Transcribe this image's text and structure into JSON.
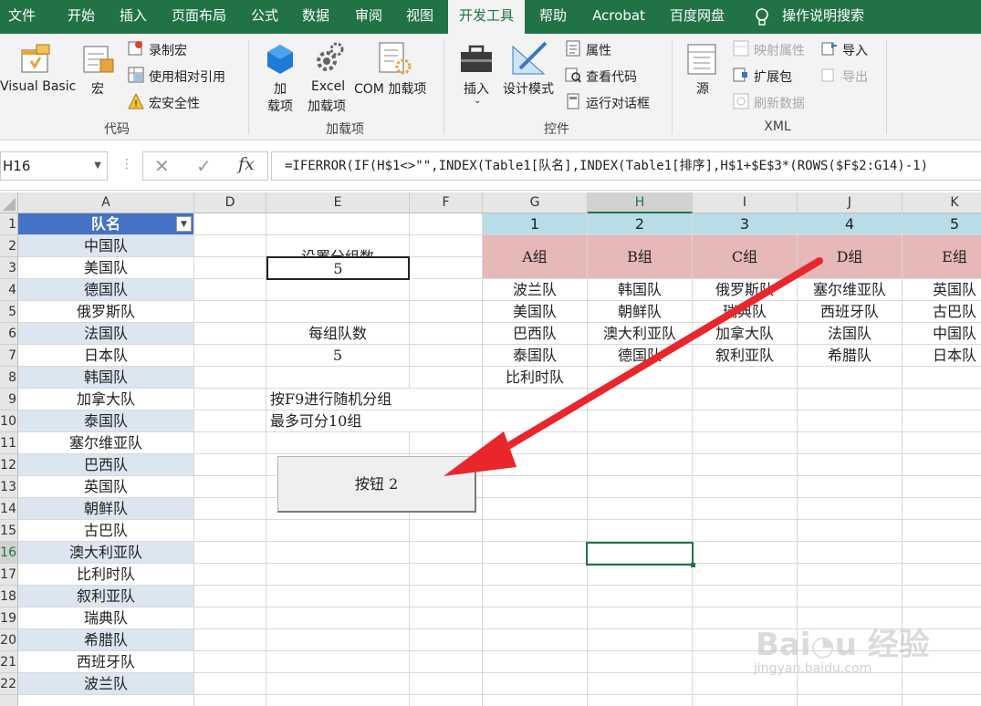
{
  "tabs": [
    "文件",
    "开始",
    "插入",
    "页面布局",
    "公式",
    "数据",
    "审阅",
    "视图",
    "开发工具",
    "帮助",
    "Acrobat",
    "百度网盘",
    "操作说明搜索"
  ],
  "active_tab": "开发工具",
  "ribbon": {
    "code": {
      "label": "代码",
      "visual_basic": "Visual Basic",
      "macro": "宏",
      "record_macro": "录制宏",
      "relative_ref": "使用相对引用",
      "macro_security": "宏安全性"
    },
    "addins": {
      "label": "加载项",
      "addin_l1": "加",
      "addin_l2": "载项",
      "excel_l1": "Excel",
      "excel_l2": "加载项",
      "com": "COM 加载项"
    },
    "controls": {
      "label": "控件",
      "insert": "插入",
      "design_mode": "设计模式",
      "properties": "属性",
      "view_code": "查看代码",
      "run_dialog": "运行对话框"
    },
    "xml": {
      "label": "XML",
      "source": "源",
      "map_props": "映射属性",
      "expansion": "扩展包",
      "refresh": "刷新数据",
      "import": "导入",
      "export": "导出"
    }
  },
  "formula_bar": {
    "name_box": "H16",
    "formula": "=IFERROR(IF(H$1<>\"\",INDEX(Table1[队名],INDEX(Table1[排序],H$1+$E$3*(ROWS($F$2:G14)-1)"
  },
  "columns": [
    "A",
    "D",
    "E",
    "F",
    "G",
    "H",
    "I",
    "J",
    "K"
  ],
  "rows": [
    "1",
    "2",
    "3",
    "4",
    "5",
    "6",
    "7",
    "8",
    "9",
    "10",
    "11",
    "12",
    "13",
    "14",
    "15",
    "16",
    "17",
    "18",
    "19",
    "20",
    "21",
    "22"
  ],
  "table": {
    "header": "队名",
    "teams": [
      "中国队",
      "美国队",
      "德国队",
      "俄罗斯队",
      "法国队",
      "日本队",
      "韩国队",
      "加拿大队",
      "泰国队",
      "塞尔维亚队",
      "巴西队",
      "英国队",
      "朝鲜队",
      "古巴队",
      "澳大利亚队",
      "比利时队",
      "叙利亚队",
      "瑞典队",
      "希腊队",
      "西班牙队",
      "波兰队"
    ]
  },
  "settings": {
    "group_count_label": "设置分组数",
    "group_count": "5",
    "per_group_label": "每组队数",
    "per_group": "5",
    "hint1": "按F9进行随机分组",
    "hint2": "最多可分10组",
    "button": "按钮 2"
  },
  "groups": {
    "numbers": [
      "1",
      "2",
      "3",
      "4",
      "5"
    ],
    "names": [
      "A组",
      "B组",
      "C组",
      "D组",
      "E组"
    ],
    "members": [
      [
        "波兰队",
        "美国队",
        "巴西队",
        "泰国队",
        "比利时队"
      ],
      [
        "韩国队",
        "朝鲜队",
        "澳大利亚队",
        "德国队"
      ],
      [
        "俄罗斯队",
        "瑞典队",
        "加拿大队",
        "叙利亚队"
      ],
      [
        "塞尔维亚队",
        "西班牙队",
        "法国队",
        "希腊队"
      ],
      [
        "英国队",
        "古巴队",
        "中国队",
        "日本队"
      ]
    ]
  },
  "colors": {
    "accent": "#217346",
    "table_header": "#4472c4",
    "band": "#dce6f1",
    "group_num": "#b8dce8",
    "group_name": "#e6b8b7",
    "arrow": "#e8262c"
  }
}
